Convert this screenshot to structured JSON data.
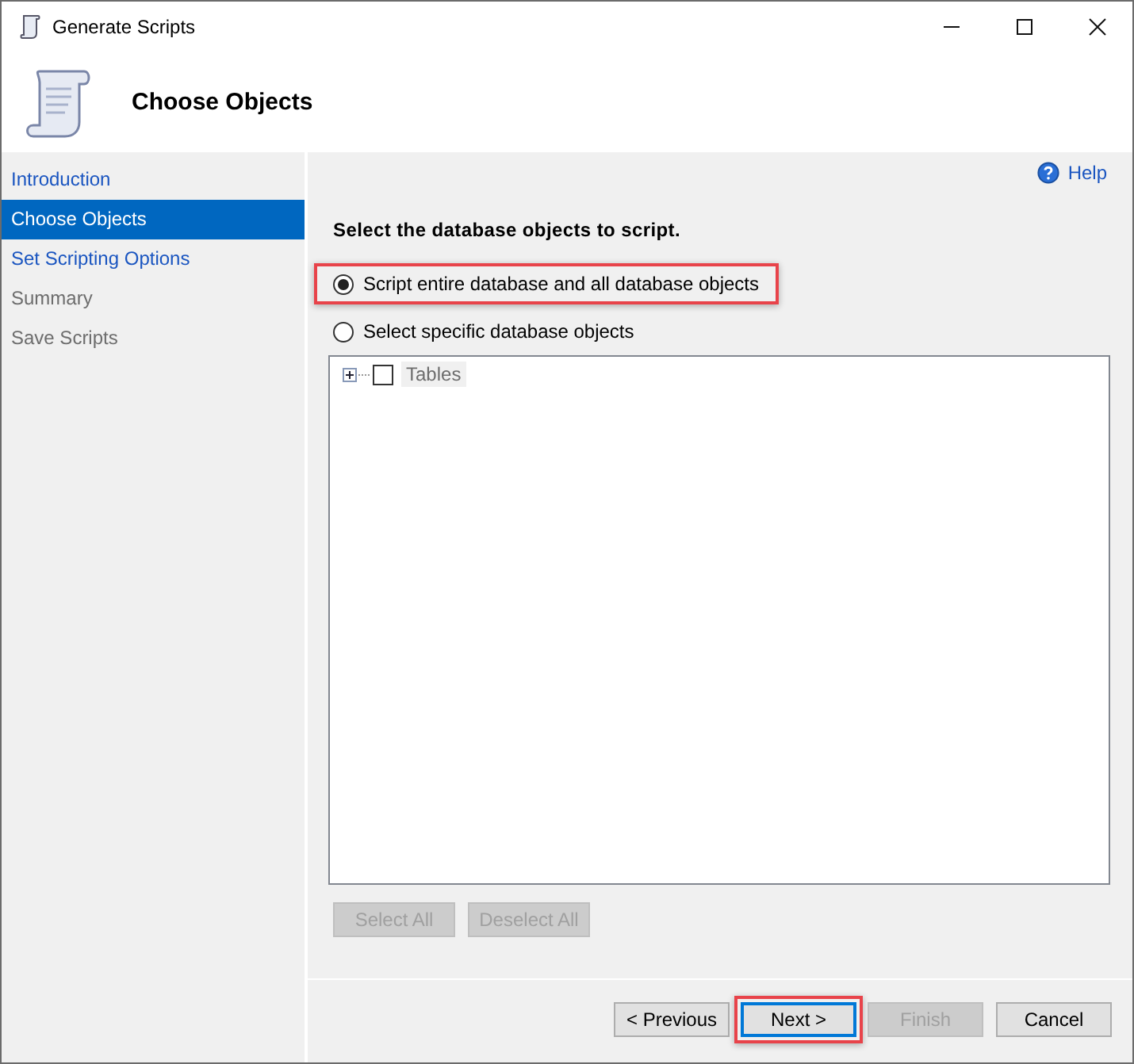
{
  "window": {
    "title": "Generate Scripts"
  },
  "header": {
    "title": "Choose Objects"
  },
  "sidebar": {
    "items": [
      {
        "label": "Introduction",
        "selected": false,
        "disabled": false
      },
      {
        "label": "Choose Objects",
        "selected": true,
        "disabled": false
      },
      {
        "label": "Set Scripting Options",
        "selected": false,
        "disabled": false
      },
      {
        "label": "Summary",
        "selected": false,
        "disabled": true
      },
      {
        "label": "Save Scripts",
        "selected": false,
        "disabled": true
      }
    ]
  },
  "help": "Help",
  "heading": "Select the database objects to script.",
  "options": [
    {
      "label": "Script entire database and all database objects",
      "selected": true,
      "highlighted": true
    },
    {
      "label": "Select specific database objects",
      "selected": false,
      "highlighted": false
    }
  ],
  "tree": {
    "items": [
      {
        "label": "Tables",
        "expanded": false,
        "checked": false
      }
    ]
  },
  "selection_buttons": [
    {
      "label": "Select All",
      "disabled": true
    },
    {
      "label": "Deselect All",
      "disabled": true
    }
  ],
  "nav_buttons": [
    {
      "label": "< Previous",
      "disabled": false,
      "default": false,
      "highlighted": false
    },
    {
      "label": "Next >",
      "disabled": false,
      "default": true,
      "highlighted": true
    },
    {
      "label": "Finish",
      "disabled": true,
      "default": false,
      "highlighted": false
    },
    {
      "label": "Cancel",
      "disabled": false,
      "default": false,
      "highlighted": false
    }
  ]
}
